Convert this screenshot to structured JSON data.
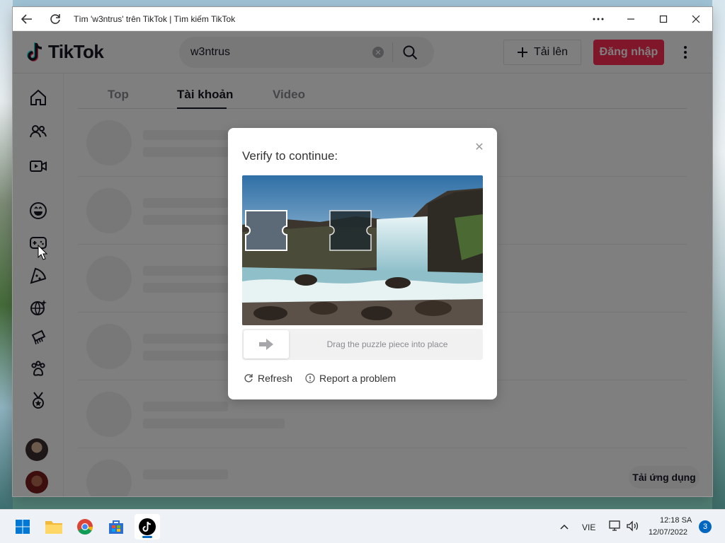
{
  "browser": {
    "title": "Tìm 'w3ntrus' trên TikTok | Tìm kiếm TikTok"
  },
  "header": {
    "logo": "TikTok",
    "search_value": "w3ntrus",
    "upload_label": "Tải lên",
    "login_label": "Đăng nhập"
  },
  "sidebar": {
    "icons": [
      "home-icon",
      "following-icon",
      "live-icon",
      "comedy-icon",
      "gaming-icon",
      "food-icon",
      "travel-icon",
      "beauty-icon",
      "animals-icon",
      "sports-icon"
    ]
  },
  "tabs": [
    {
      "label": "Top"
    },
    {
      "label": "Tài khoản"
    },
    {
      "label": "Video"
    }
  ],
  "get_app_label": "Tải ứng dụng",
  "captcha": {
    "title": "Verify to continue:",
    "slider_hint": "Drag the puzzle piece into place",
    "refresh_label": "Refresh",
    "report_label": "Report a problem"
  },
  "taskbar": {
    "language": "VIE",
    "time": "12:18 SA",
    "date": "12/07/2022",
    "notification_count": "3"
  },
  "colors": {
    "accent": "#fe2c55",
    "text": "#161823",
    "taskbar_accent": "#0067c0"
  }
}
